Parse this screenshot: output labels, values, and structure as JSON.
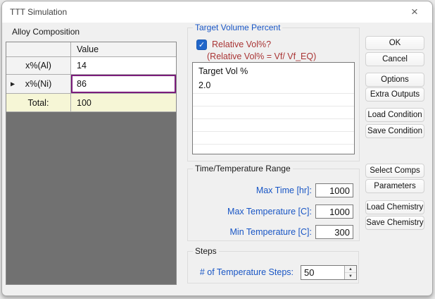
{
  "window": {
    "title": "TTT Simulation"
  },
  "icons": {
    "close": "×",
    "row_selector": "▶",
    "checkbox_check": "✓",
    "spinner_up": "▲",
    "spinner_down": "▼"
  },
  "alloy_composition": {
    "label": "Alloy Composition",
    "table": {
      "value_header": "Value",
      "rows": [
        {
          "name": "x%(Al)",
          "value": "14"
        },
        {
          "name": "x%(Ni)",
          "value": "86"
        },
        {
          "name": "Total:",
          "value": "100"
        }
      ]
    }
  },
  "target_volume": {
    "group_label": "Target Volume Percent",
    "checkbox_label": "Relative Vol%?",
    "checkbox_checked": true,
    "formula_note": "(Relative Vol% = Vf/ Vf_EQ)",
    "list": {
      "header": "Target Vol %",
      "values": [
        "2.0"
      ]
    }
  },
  "time_temperature": {
    "group_label": "Time/Temperature Range",
    "fields": [
      {
        "label": "Max Time [hr]:",
        "value": "1000"
      },
      {
        "label": "Max Temperature [C]:",
        "value": "1000"
      },
      {
        "label": "Min Temperature [C]:",
        "value": "300"
      }
    ]
  },
  "steps": {
    "group_label": "Steps",
    "field_label": "# of Temperature Steps:",
    "value": "50"
  },
  "buttons": {
    "ok": "OK",
    "cancel": "Cancel",
    "options": "Options",
    "extra_outputs": "Extra Outputs",
    "load_condition": "Load Condition",
    "save_condition": "Save Condition",
    "select_comps": "Select Comps",
    "parameters": "Parameters",
    "load_chemistry": "Load Chemistry",
    "save_chemistry": "Save Chemistry"
  },
  "colors": {
    "label_blue": "#1956c5",
    "note_red": "#a93434",
    "selected_cell_border": "#7b1d7b",
    "total_row_bg": "#f6f6d6",
    "grid_filler_gray": "#717171",
    "checkbox_blue": "#2166c9"
  }
}
